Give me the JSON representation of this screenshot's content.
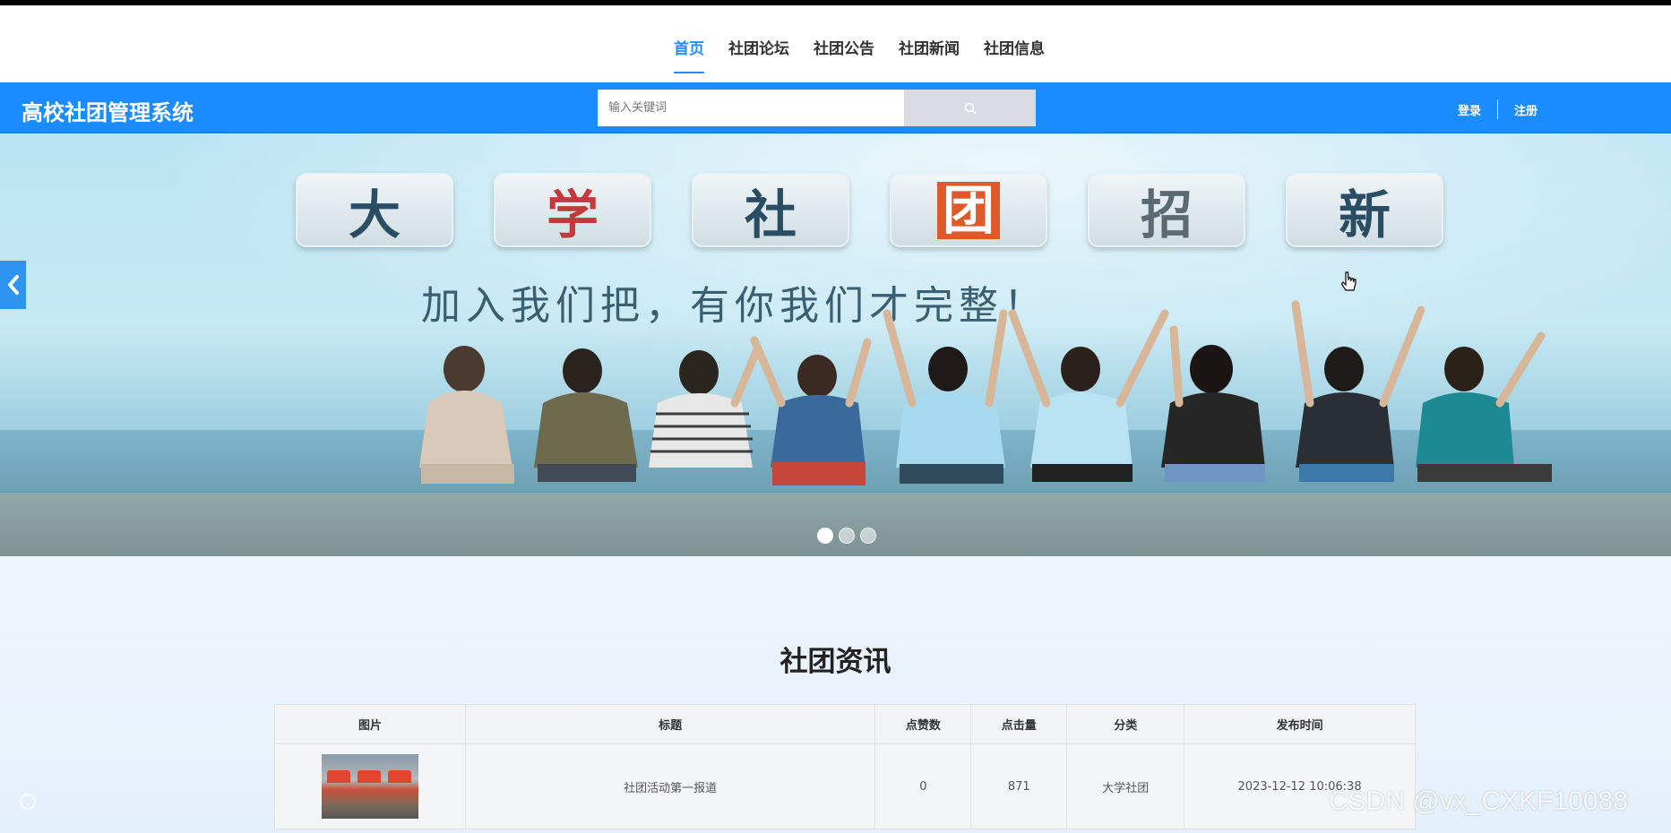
{
  "topnav": {
    "items": [
      {
        "label": "首页",
        "active": true
      },
      {
        "label": "社团论坛",
        "active": false
      },
      {
        "label": "社团公告",
        "active": false
      },
      {
        "label": "社团新闻",
        "active": false
      },
      {
        "label": "社团信息",
        "active": false
      }
    ]
  },
  "header": {
    "site_title": "高校社团管理系统",
    "search": {
      "placeholder": "输入关键词",
      "button_icon": "search-icon"
    },
    "login_label": "登录",
    "register_label": "注册",
    "bar_color": "#1a8cff"
  },
  "banner": {
    "tiles": [
      "大",
      "学",
      "社",
      "团",
      "招",
      "新"
    ],
    "slogan": "加入我们把，有你我们才完整！",
    "prev_icon": "chevron-left-icon",
    "slides": 3,
    "active_slide": 0
  },
  "news": {
    "section_title": "社团资讯",
    "columns": [
      "图片",
      "标题",
      "点赞数",
      "点击量",
      "分类",
      "发布时间"
    ],
    "rows": [
      {
        "image_icon": "thumbnail-image",
        "title": "社团活动第一报道",
        "likes": "0",
        "clicks": "871",
        "category": "大学社团",
        "published": "2023-12-12 10:06:38"
      }
    ]
  },
  "watermark": "CSDN @vx_CXKF10088",
  "accent_color": "#1e8fff"
}
